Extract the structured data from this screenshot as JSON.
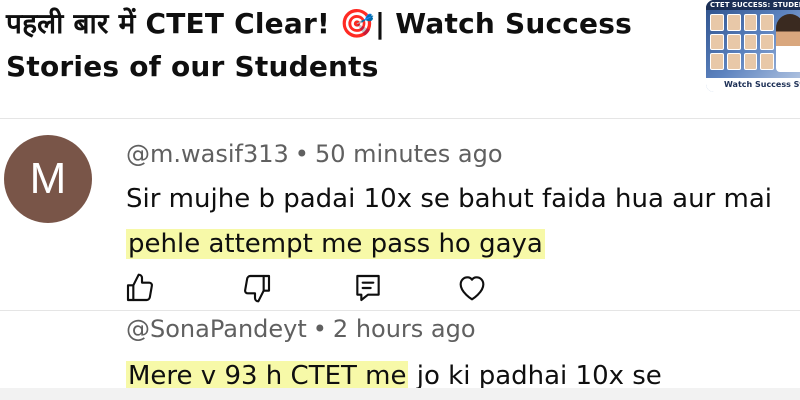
{
  "video": {
    "title": "पहली बार में CTET Clear! 🎯| Watch Success Stories of our Students",
    "thumbnail": {
      "banner_text": "CTET SUCCESS: STUDENT",
      "footer_text": "Watch Success Stories"
    }
  },
  "comments": [
    {
      "avatar_letter": "M",
      "avatar_color": "#795548",
      "author": "@m.wasif313",
      "separator": "•",
      "time": "50 minutes ago",
      "line1": "Sir mujhe b padai 10x se bahut faida hua aur mai",
      "line2_highlighted": "pehle attempt me pass ho gaya",
      "actions": {
        "like_icon": "thumbs-up-icon",
        "dislike_icon": "thumbs-down-icon",
        "reply_icon": "reply-icon",
        "heart_icon": "heart-icon"
      }
    },
    {
      "author": "@SonaPandeyt",
      "separator": "•",
      "time": "2 hours ago",
      "highlighted": "Mere v 93 h CTET me",
      "rest": " jo ki padhai 10x se"
    }
  ],
  "colors": {
    "highlight": "#f7f9a8",
    "meta_text": "#606060",
    "text": "#0f0f0f"
  }
}
